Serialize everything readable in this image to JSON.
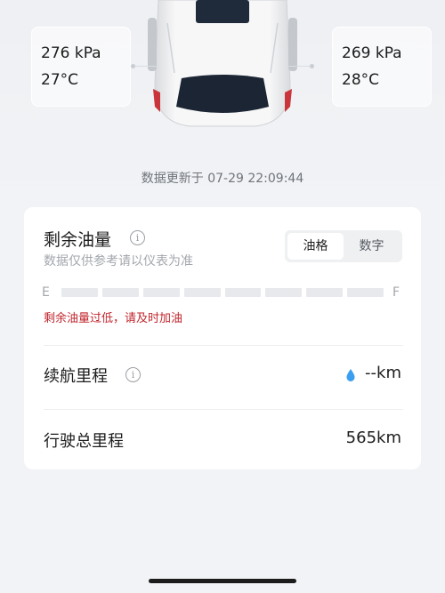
{
  "tires": {
    "front_left": {
      "pressure": "276 kPa",
      "temperature": "27°C"
    },
    "front_right": {
      "pressure": "269 kPa",
      "temperature": "28°C"
    }
  },
  "update_time": "数据更新于 07-29 22:09:44",
  "fuel": {
    "title": "剩余油量",
    "subtitle": "数据仅供参考请以仪表为准",
    "toggle": {
      "option_fuel": "油格",
      "option_number": "数字",
      "selected": "油格"
    },
    "gauge_start": "E",
    "gauge_end": "F",
    "gauge_level": 0,
    "warning": "剩余油量过低，请及时加油"
  },
  "range": {
    "label": "续航里程",
    "value": "--km"
  },
  "odometer": {
    "label": "行驶总里程",
    "value": "565km"
  },
  "colors": {
    "warning": "#c0262d",
    "accent_drop": "#3a9ff0"
  }
}
